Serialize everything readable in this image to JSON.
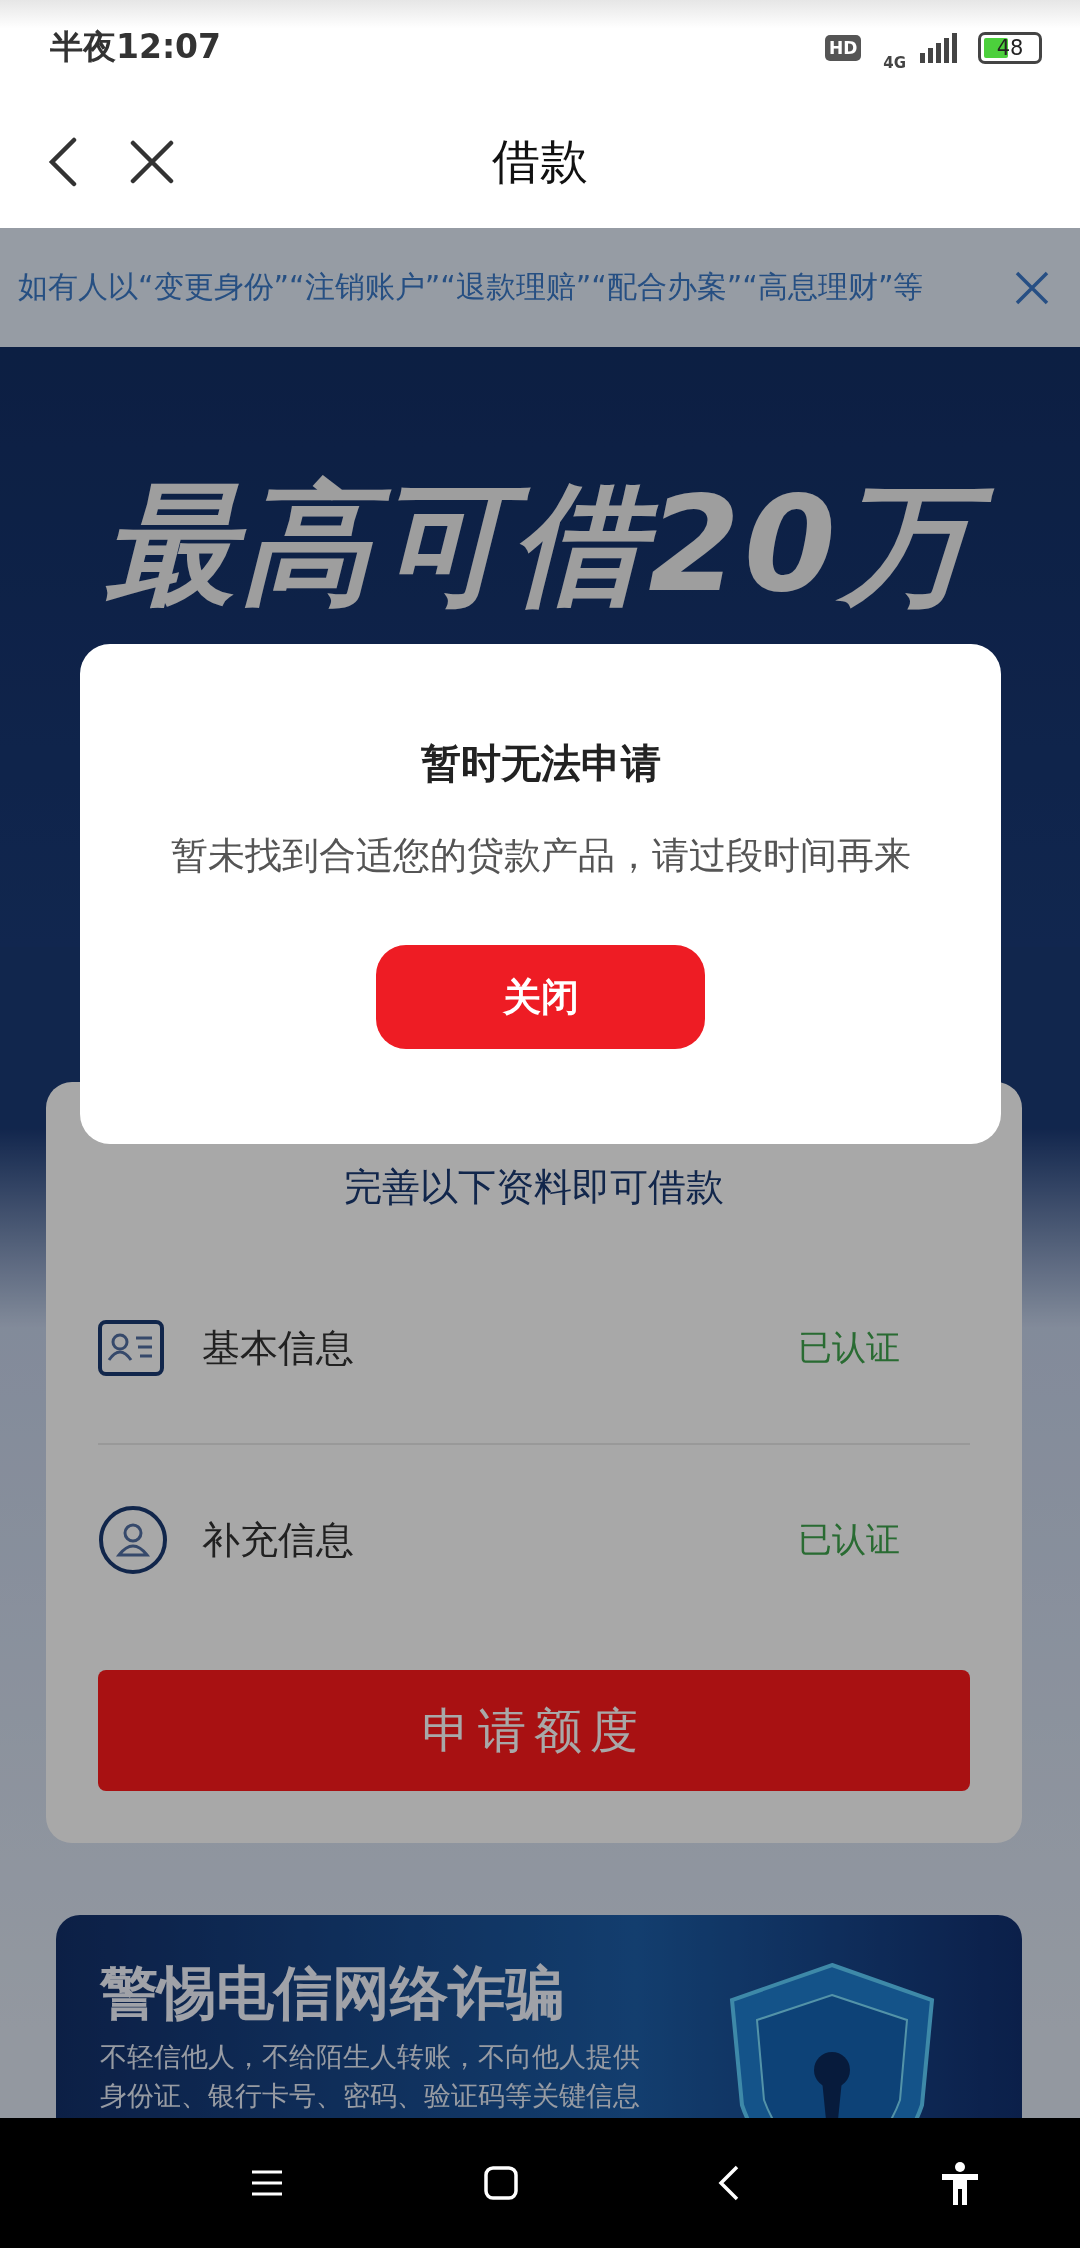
{
  "status_bar": {
    "time": "半夜12:07",
    "hd": "HD",
    "network": "4G",
    "battery": "48"
  },
  "header": {
    "title": "借款"
  },
  "notice": {
    "text": "如有人以“变更身份”“注销账户”“退款理赔”“配合办案”“高息理财”等"
  },
  "hero": {
    "title": "最高可借20万"
  },
  "form_card": {
    "title": "完善以下资料即可借款",
    "items": [
      {
        "kind": "id-card",
        "label": "基本信息",
        "status": "已认证"
      },
      {
        "kind": "person",
        "label": "补充信息",
        "status": "已认证"
      }
    ],
    "button": "申请额度"
  },
  "banner": {
    "title": "警惕电信网络诈骗",
    "text": "不轻信他人，不给陌生人转账，不向他人提供身份证、银行卡号、密码、验证码等关键信息"
  },
  "dialog": {
    "title": "暂时无法申请",
    "message": "暂未找到合适您的贷款产品，请过段时间再来",
    "button": "关闭"
  }
}
